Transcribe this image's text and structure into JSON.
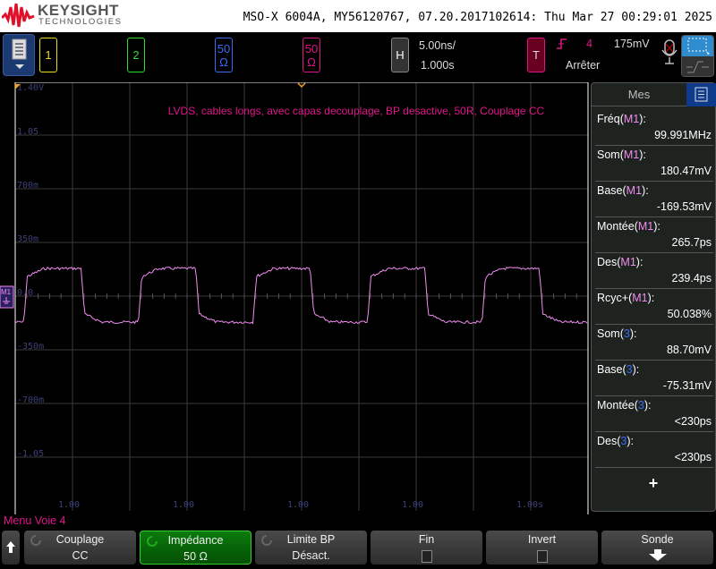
{
  "header": {
    "brand": "KEYSIGHT",
    "brand_sub": "TECHNOLOGIES",
    "instrument": "MSO-X 6004A, MY56120767, 07.20.2017102614: Thu Mar 27 00:29:01 2025"
  },
  "channels": [
    {
      "label": "1",
      "color": "#e8e01c"
    },
    {
      "label": "2",
      "color": "#2ee02e"
    },
    {
      "label": "50",
      "unit": "Ω",
      "color": "#3a6cf5"
    },
    {
      "label": "50",
      "unit": "Ω",
      "color": "#e0158a"
    }
  ],
  "horizontal": {
    "button": "H",
    "scale": "5.00ns/",
    "delay": "1.000s"
  },
  "trigger": {
    "button": "T",
    "source": "4",
    "level": "175mV",
    "status": "Arrêter"
  },
  "plot": {
    "annotation": "LVDS, cables longs, avec capas decouplage, BP desactive, 50R, Couplage CC",
    "y_labels": [
      "1.40V",
      "1.05",
      "700m",
      "350m",
      "0.0",
      "-350m",
      "-700m",
      "-1.05"
    ],
    "x_labels": [
      "1.00",
      "1.00",
      "1.00",
      "1.00",
      "1.00s"
    ],
    "marker": "M1",
    "trace_color": "#f08cf0",
    "waveform": {
      "period_ns": 10,
      "high_mV": 180.47,
      "low_mV": -169.53,
      "duty_pct": 50.038,
      "first_rise_ns": 0.75,
      "time_per_div_ns": 5,
      "volts_per_div_mV": 350
    }
  },
  "measurements": {
    "title": "Mes",
    "items": [
      {
        "name": "Fréq",
        "src": "M1",
        "value": "99.991MHz"
      },
      {
        "name": "Som",
        "src": "M1",
        "value": "180.47mV"
      },
      {
        "name": "Base",
        "src": "M1",
        "value": "-169.53mV"
      },
      {
        "name": "Montée",
        "src": "M1",
        "value": "265.7ps"
      },
      {
        "name": "Des",
        "src": "M1",
        "value": "239.4ps"
      },
      {
        "name": "Rcyc+",
        "src": "M1",
        "value": "50.038%"
      },
      {
        "name": "Som",
        "src": "3",
        "value": "88.70mV"
      },
      {
        "name": "Base",
        "src": "3",
        "value": "-75.31mV"
      },
      {
        "name": "Montée",
        "src": "3",
        "value": "<230ps"
      },
      {
        "name": "Des",
        "src": "3",
        "value": "<230ps"
      }
    ],
    "add": "+"
  },
  "menu": {
    "title": "Menu Voie 4",
    "softkeys": [
      {
        "label": "Couplage",
        "value": "CC"
      },
      {
        "label": "Impédance",
        "value": "50 Ω",
        "active": true
      },
      {
        "label": "Limite BP",
        "value": "Désact."
      },
      {
        "label": "Fin",
        "checkbox": true
      },
      {
        "label": "Invert",
        "checkbox": true
      },
      {
        "label": "Sonde",
        "arrow": true
      }
    ]
  }
}
